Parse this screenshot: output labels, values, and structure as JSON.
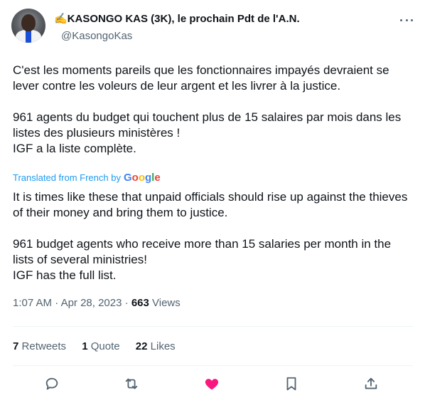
{
  "author": {
    "display_name": "✍️KASONGO KAS (3K), le prochain Pdt de l'A.N.",
    "handle": "@KasongoKas"
  },
  "tweet": {
    "original_text": "C'est les moments pareils que les fonctionnaires impayés devraient se  lever contre les voleurs de leur argent et les livrer à la justice.\n\n961 agents du budget qui touchent plus de 15 salaires par mois dans les listes des plusieurs ministères !\nIGF a la liste complète.",
    "translated_note": "Translated from French by",
    "translator": "Google",
    "translated_text": "It is times like these that unpaid officials should rise up against the thieves of their money and bring them to justice.\n\n961 budget agents who receive more than 15 salaries per month in the lists of several ministries!\nIGF has the full list.",
    "time": "1:07 AM",
    "date": "Apr 28, 2023",
    "views_count": "663",
    "views_label": "Views"
  },
  "stats": {
    "retweets_count": "7",
    "retweets_label": "Retweets",
    "quotes_count": "1",
    "quotes_label": "Quote",
    "likes_count": "22",
    "likes_label": "Likes"
  },
  "actions": {
    "reply_icon": "speech-bubble",
    "retweet_icon": "retweet-arrows",
    "like_icon": "heart-filled",
    "bookmark_icon": "bookmark",
    "share_icon": "share-upload"
  },
  "colors": {
    "text": "#0f1419",
    "secondary": "#536471",
    "link": "#1d9bf0",
    "like": "#f91880"
  }
}
